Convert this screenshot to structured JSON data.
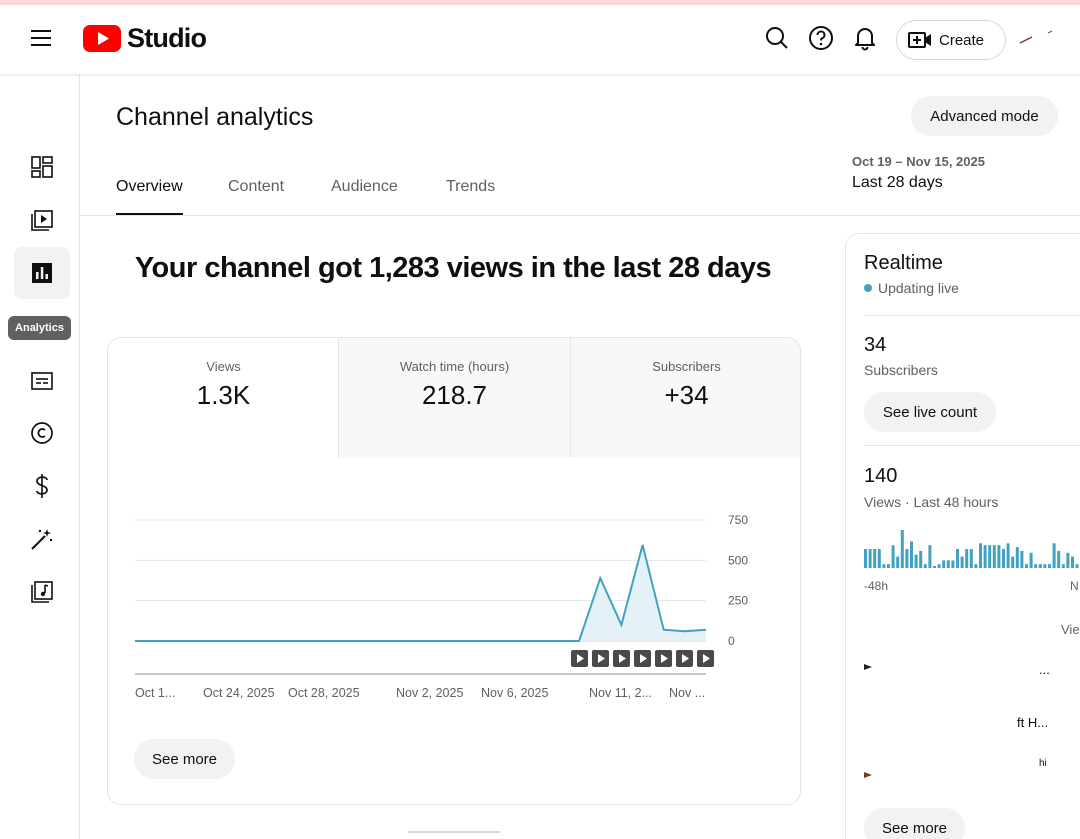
{
  "header": {
    "logo_text": "Studio",
    "create_label": "Create",
    "icons": [
      "menu-icon",
      "youtube-logo-icon",
      "search-icon",
      "help-icon",
      "notifications-icon",
      "create-video-icon"
    ]
  },
  "sidebar": {
    "items": [
      {
        "name": "dashboard",
        "icon": "dashboard-icon"
      },
      {
        "name": "content",
        "icon": "content-icon"
      },
      {
        "name": "analytics",
        "icon": "analytics-icon",
        "active": true
      },
      {
        "name": "subtitles",
        "icon": "subtitles-icon"
      },
      {
        "name": "copyright",
        "icon": "copyright-icon"
      },
      {
        "name": "earn",
        "icon": "earn-icon"
      },
      {
        "name": "customization",
        "icon": "customization-icon"
      },
      {
        "name": "audio-library",
        "icon": "audio-library-icon"
      }
    ],
    "tooltip": "Analytics"
  },
  "page": {
    "title": "Channel analytics",
    "advanced_mode": "Advanced mode",
    "tabs": [
      "Overview",
      "Content",
      "Audience",
      "Trends"
    ],
    "date_range": "Oct 19 – Nov 15, 2025",
    "date_label": "Last 28 days",
    "headline": "Your channel got 1,283 views in the last 28 days"
  },
  "metrics": [
    {
      "label": "Views",
      "value": "1.3K"
    },
    {
      "label": "Watch time (hours)",
      "value": "218.7"
    },
    {
      "label": "Subscribers",
      "value": "+34"
    }
  ],
  "chart_data": {
    "type": "area",
    "title": "",
    "xlabel": "",
    "ylabel": "",
    "y_ticks": [
      "750",
      "500",
      "250",
      "0"
    ],
    "ylim": [
      0,
      750
    ],
    "x_tick_labels": [
      "Oct 1...",
      "Oct 24, 2025",
      "Oct 28, 2025",
      "Nov 2, 2025",
      "Nov 6, 2025",
      "Nov 11, 2...",
      "Nov ..."
    ],
    "series": [
      {
        "color": "#41a1c0",
        "values": [
          0,
          0,
          0,
          0,
          0,
          0,
          0,
          0,
          0,
          0,
          0,
          0,
          0,
          0,
          0,
          0,
          0,
          0,
          0,
          0,
          0,
          0,
          390,
          100,
          595,
          70,
          60,
          70
        ]
      }
    ],
    "video_markers": 7,
    "grid": true
  },
  "see_more_label": "See more",
  "realtime": {
    "title": "Realtime",
    "status": "Updating live",
    "subscribers_value": "34",
    "subscribers_label": "Subscribers",
    "see_live_count": "See live count",
    "views_value": "140",
    "views_label": "Views · Last 48 hours",
    "axis_start": "-48h",
    "axis_end": "N",
    "views_col": "Vie",
    "rows": [
      "...",
      "ft H...",
      "hi"
    ],
    "bar_values": [
      0.5,
      0.5,
      0.5,
      0.5,
      0.1,
      0.1,
      0.6,
      0.3,
      1.0,
      0.5,
      0.7,
      0.35,
      0.45,
      0.1,
      0.6,
      0.05,
      0.1,
      0.2,
      0.2,
      0.2,
      0.5,
      0.3,
      0.5,
      0.5,
      0.1,
      0.65,
      0.6,
      0.6,
      0.6,
      0.6,
      0.5,
      0.65,
      0.3,
      0.55,
      0.45,
      0.1,
      0.4,
      0.1,
      0.1,
      0.1,
      0.1,
      0.65,
      0.45,
      0.1,
      0.4,
      0.3,
      0.1,
      0.55,
      0.45,
      0.1,
      0.7,
      1.0
    ],
    "bar_color": "#41a1c0"
  }
}
